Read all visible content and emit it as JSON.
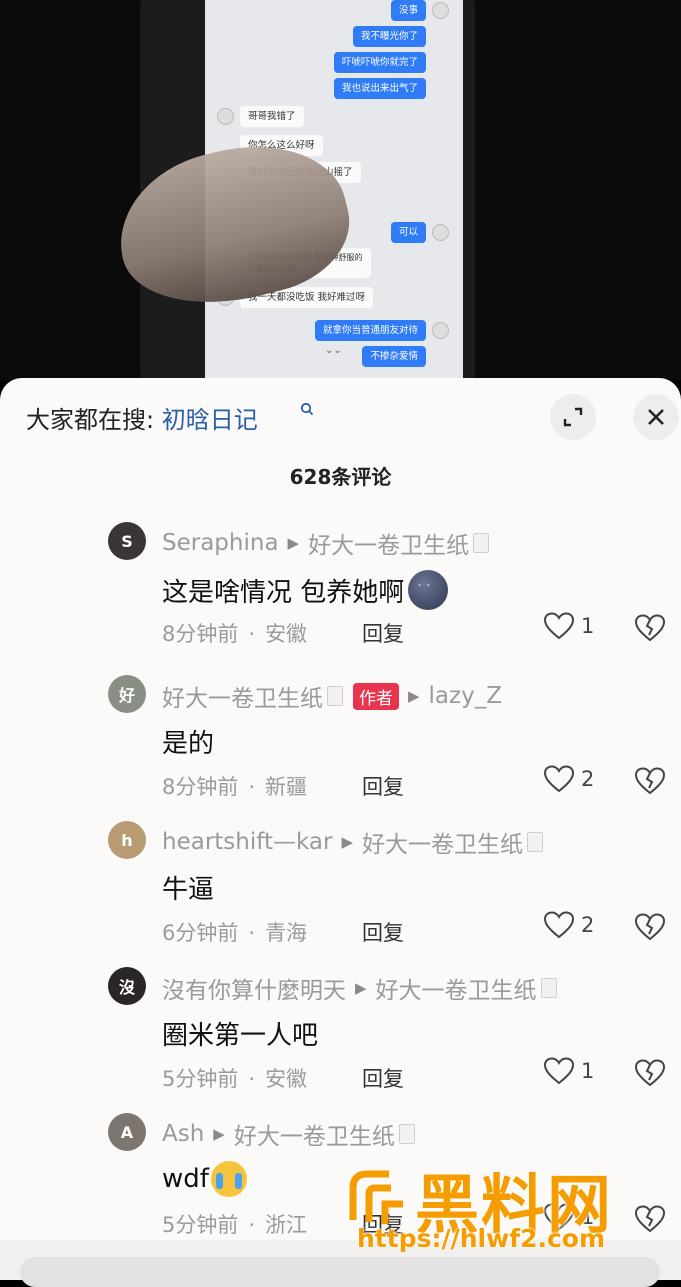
{
  "video": {
    "chat": {
      "right_top": [
        "没事",
        "我不曝光你了",
        "吓唬吓唬你就完了",
        "我也说出来出气了"
      ],
      "left_mid": [
        "哥哥我错了",
        "你怎么这么好呀",
        "我以为你已经地动山摇了"
      ],
      "right_mid": [
        "可以"
      ],
      "left_note": [
        "之后咱们好好回归 就那种舒服的",
        "心模式可以吗"
      ],
      "left_low": [
        "我一天都没吃饭 我好难过呀"
      ],
      "right_low": [
        "就拿你当普通朋友对待",
        "不掺杂爱情"
      ]
    }
  },
  "search": {
    "label": "大家都在搜: ",
    "query": "初晗日记"
  },
  "comment_count": "628条评论",
  "reply_label": "回复",
  "comments": [
    {
      "user": "Seraphina",
      "reply_to": "好大一卷卫生纸",
      "text": "这是啥情况 包养她啊",
      "time": "8分钟前",
      "location": "安徽",
      "likes": "1",
      "author_badge": "",
      "avatar_color": "#3b3535"
    },
    {
      "user": "好大一卷卫生纸",
      "reply_to": "lazy_Z",
      "text": "是的",
      "time": "8分钟前",
      "location": "新疆",
      "likes": "2",
      "author_badge": "作者",
      "avatar_color": "#8a8f86"
    },
    {
      "user": "heartshift—kar",
      "reply_to": "好大一卷卫生纸",
      "text": "牛逼",
      "time": "6分钟前",
      "location": "青海",
      "likes": "2",
      "author_badge": "",
      "avatar_color": "#b89b72"
    },
    {
      "user": "沒有你算什麼明天",
      "reply_to": "好大一卷卫生纸",
      "text": "圈米第一人吧",
      "time": "5分钟前",
      "location": "安徽",
      "likes": "1",
      "author_badge": "",
      "avatar_color": "#2b2626"
    },
    {
      "user": "Ash",
      "reply_to": "好大一卷卫生纸",
      "text": "wdf",
      "time": "5分钟前",
      "location": "浙江",
      "likes": "1",
      "author_badge": "",
      "avatar_color": "#7d7670"
    }
  ],
  "watermark": {
    "title": "黑料网",
    "url": "https://hlwf2.com"
  },
  "colors": {
    "accent": "#2a5ea8",
    "author_badge": "#e8344e",
    "watermark": "#f59d00"
  }
}
